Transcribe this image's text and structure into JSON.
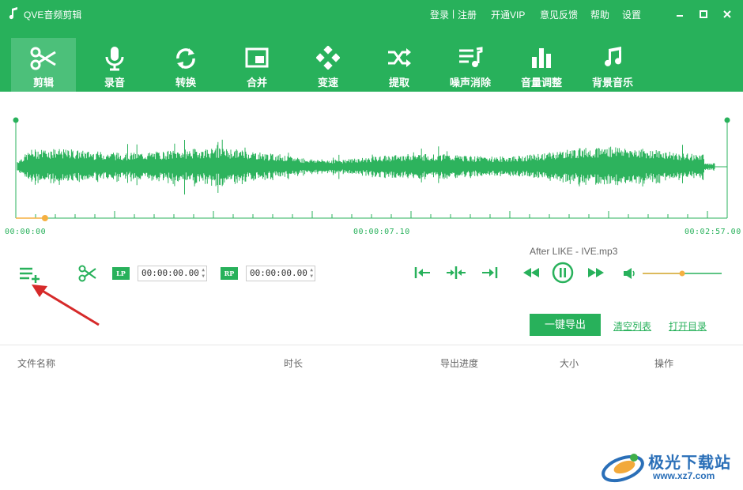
{
  "app": {
    "title": "QVE音频剪辑",
    "menu": {
      "login": "登录",
      "separator": "|",
      "register": "注册",
      "vip": "开通VIP",
      "feedback": "意见反馈",
      "help": "帮助",
      "settings": "设置"
    }
  },
  "toolbar": [
    {
      "label": "剪辑",
      "icon": "scissors-icon",
      "active": true
    },
    {
      "label": "录音",
      "icon": "microphone-icon",
      "active": false
    },
    {
      "label": "转换",
      "icon": "convert-icon",
      "active": false
    },
    {
      "label": "合并",
      "icon": "merge-icon",
      "active": false
    },
    {
      "label": "变速",
      "icon": "speed-icon",
      "active": false
    },
    {
      "label": "提取",
      "icon": "shuffle-icon",
      "active": false
    },
    {
      "label": "噪声消除",
      "icon": "noise-icon",
      "active": false
    },
    {
      "label": "音量调整",
      "icon": "volume-bars-icon",
      "active": false
    },
    {
      "label": "背景音乐",
      "icon": "music-note-icon",
      "active": false
    }
  ],
  "waveform": {
    "time_start": "00:00:00",
    "time_mid": "00:00:07.10",
    "time_end": "00:02:57.00",
    "playhead_fraction": 0.041
  },
  "player": {
    "file_name": "After LIKE - IVE.mp3",
    "lp_label": "LP",
    "rp_label": "RP",
    "lp_time": "00:00:00.00",
    "rp_time": "00:00:00.00",
    "volume_fraction": 0.5
  },
  "actions": {
    "export": "一键导出",
    "clear": "清空列表",
    "open_dir": "打开目录"
  },
  "table": {
    "columns": [
      "文件名称",
      "时长",
      "导出进度",
      "大小",
      "操作"
    ]
  },
  "watermark": {
    "title": "极光下载站",
    "url": "www.xz7.com"
  },
  "colors": {
    "primary": "#28b15b",
    "active_tab": "#4cc07a",
    "accent": "#f5b041",
    "arrow": "#d62a2a"
  }
}
